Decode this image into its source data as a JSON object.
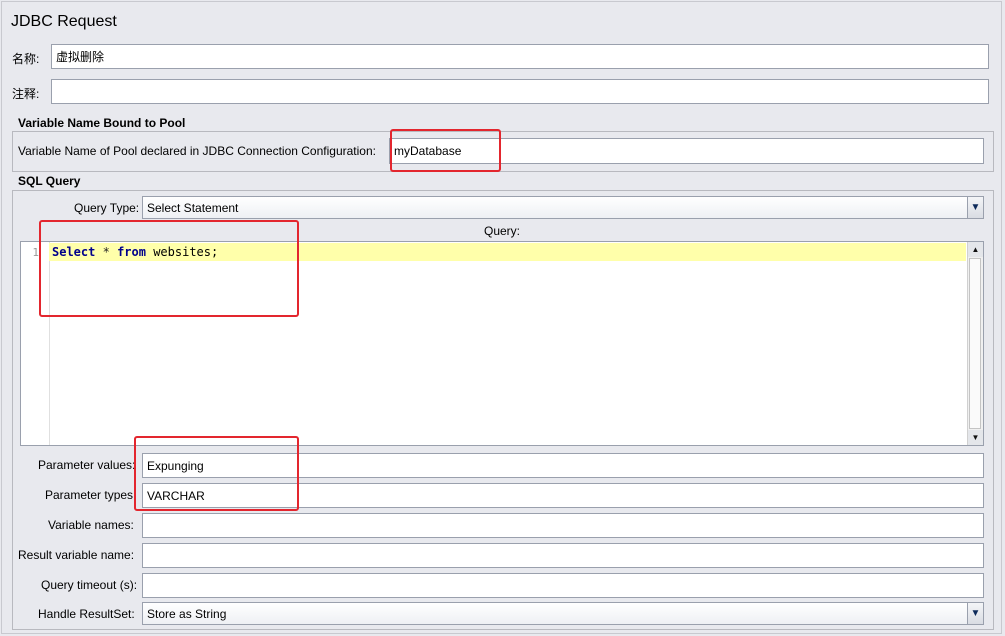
{
  "panel": {
    "title": "JDBC Request"
  },
  "name": {
    "label": "名称:",
    "value": "虚拟删除"
  },
  "comment": {
    "label": "注释:",
    "value": ""
  },
  "pool_section": {
    "heading": "Variable Name Bound to Pool",
    "label": "Variable Name of Pool declared in JDBC Connection Configuration:",
    "value": "myDatabase"
  },
  "sql_section": {
    "heading": "SQL Query",
    "query_type_label": "Query Type:",
    "query_type_value": "Select Statement",
    "query_label": "Query:",
    "line_number": "1",
    "code": {
      "kw1": "Select",
      "op": "*",
      "kw2": "from",
      "ident": "websites;"
    }
  },
  "params": {
    "values_label": "Parameter values:",
    "values_value": "Expunging",
    "types_label": "Parameter types:",
    "types_value": "VARCHAR",
    "varnames_label": "Variable names:",
    "varnames_value": "",
    "result_label": "Result variable name:",
    "result_value": "",
    "timeout_label": "Query timeout (s):",
    "timeout_value": "",
    "handle_label": "Handle ResultSet:",
    "handle_value": "Store as String"
  },
  "icons": {
    "dropdown": "triangle-down-icon",
    "scroll_up": "triangle-up-icon",
    "scroll_down": "triangle-down-icon"
  },
  "colors": {
    "highlight_box": "#e3262e",
    "current_line": "#ffffaa",
    "keyword": "#00008b"
  }
}
